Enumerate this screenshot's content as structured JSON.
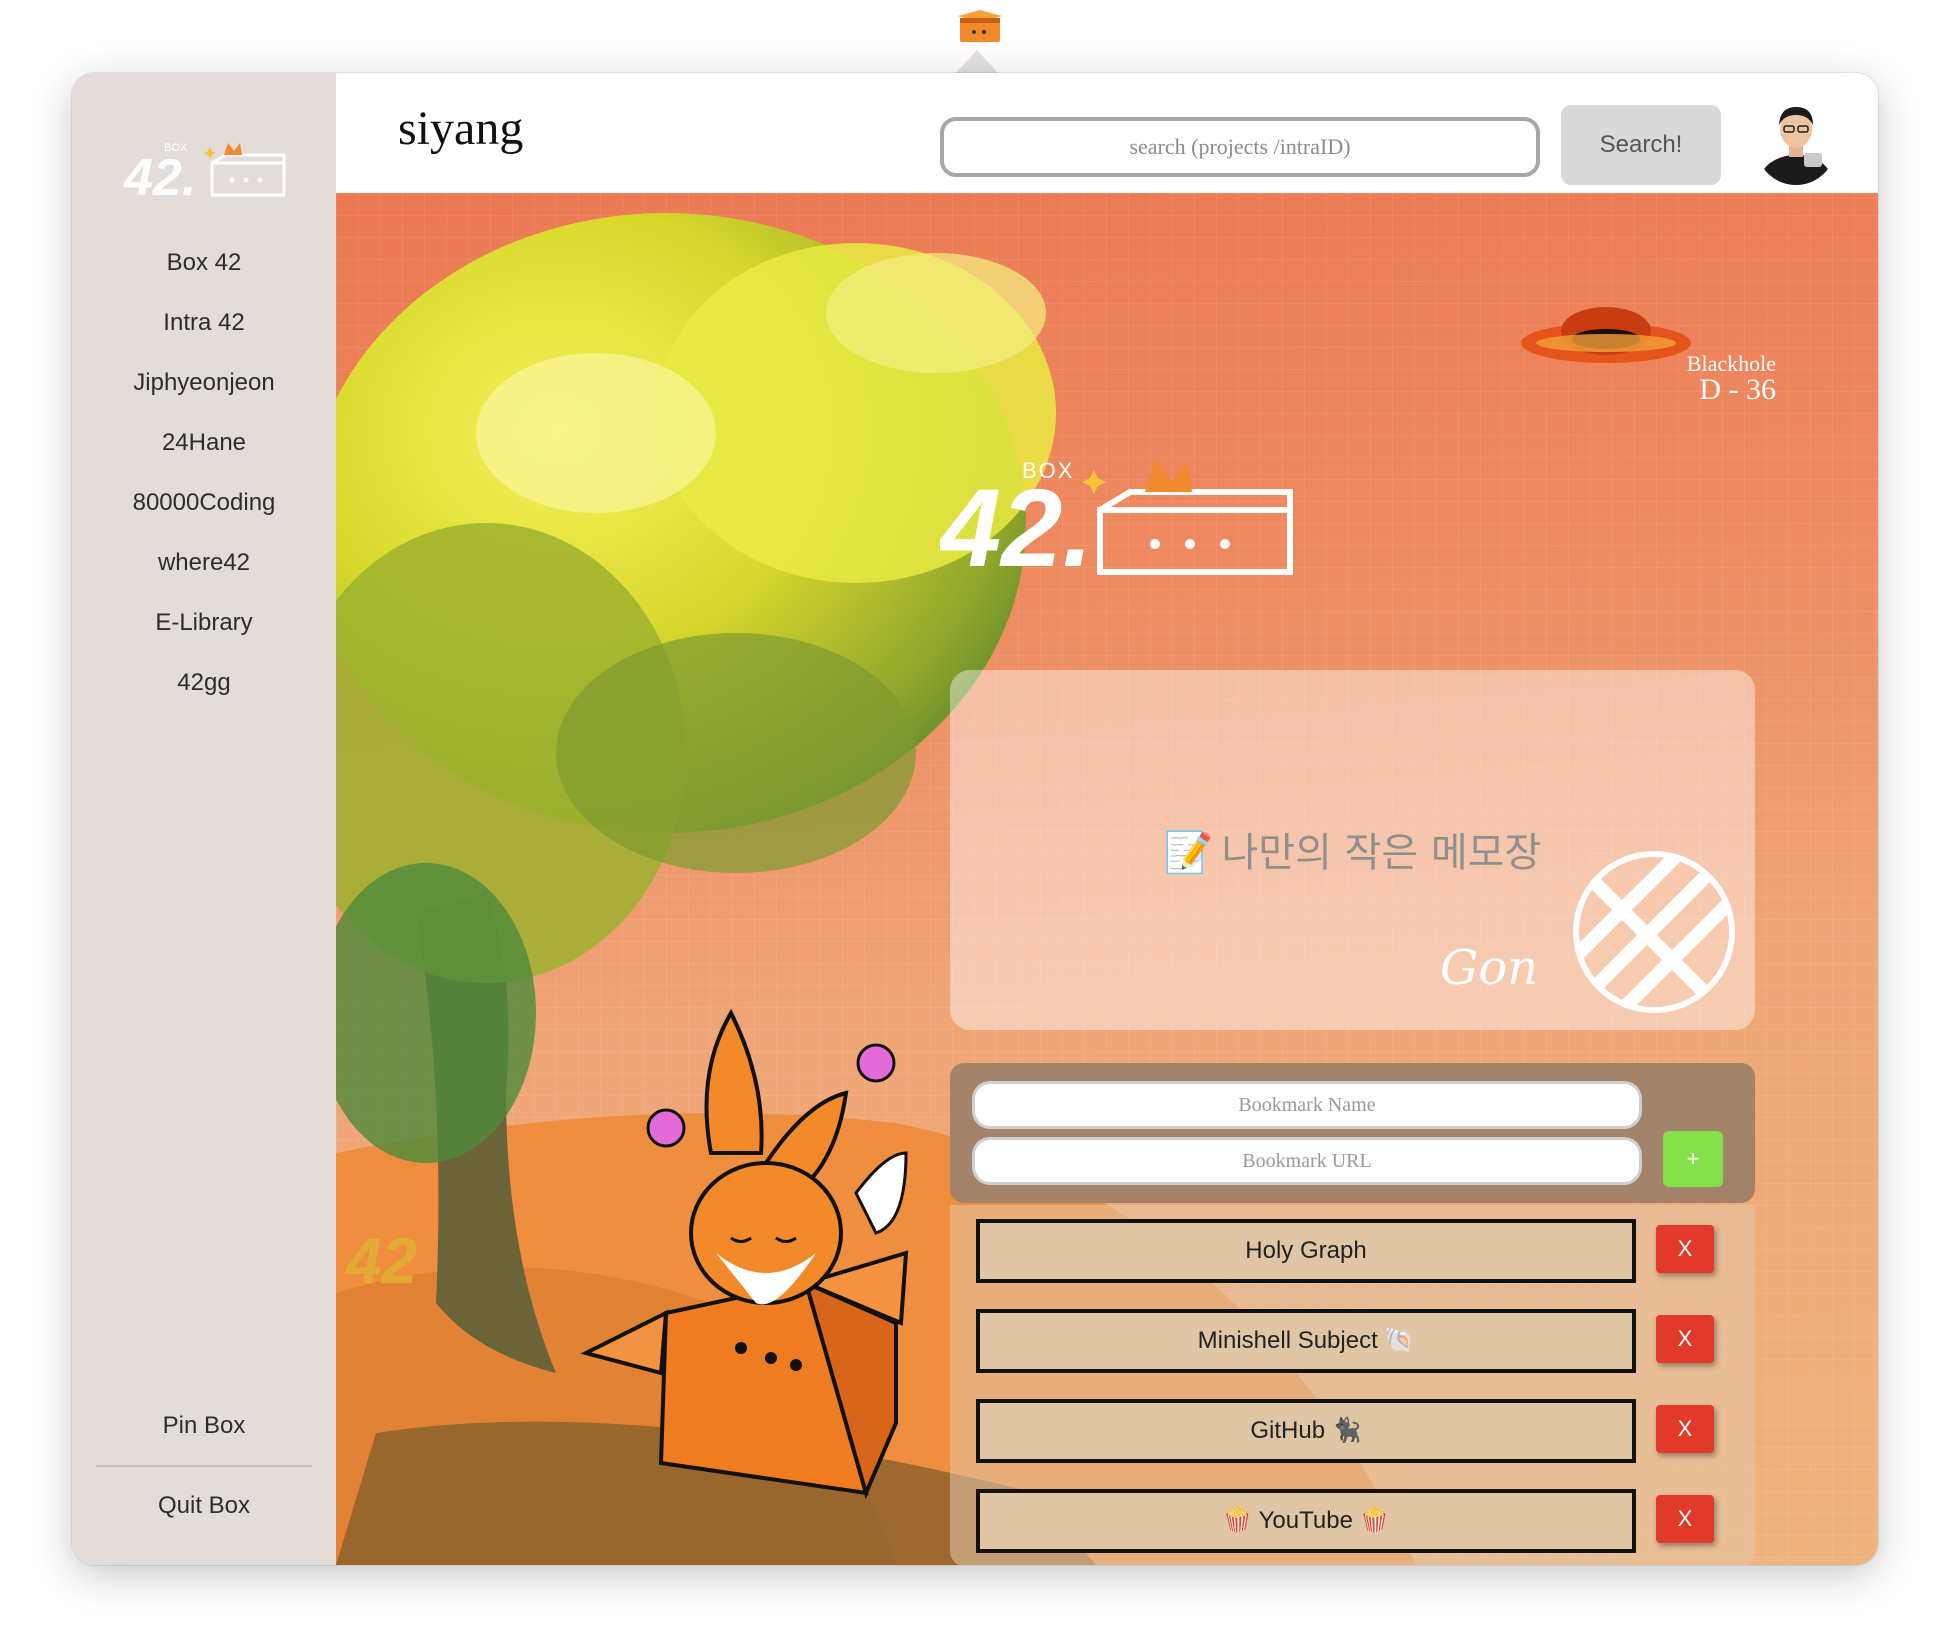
{
  "window": {
    "tray_icon": "box-42-tray-icon"
  },
  "sidebar": {
    "logo_icon": "box-42-logo",
    "items": [
      {
        "label": "Box 42"
      },
      {
        "label": "Intra 42"
      },
      {
        "label": "Jiphyeonjeon"
      },
      {
        "label": "24Hane"
      },
      {
        "label": "80000Coding"
      },
      {
        "label": "where42"
      },
      {
        "label": "E-Library"
      },
      {
        "label": "42gg"
      }
    ],
    "pin_label": "Pin Box",
    "quit_label": "Quit Box"
  },
  "header": {
    "user_name": "siyang",
    "search_placeholder": "search (projects /intraID)",
    "search_value": "",
    "search_button": "Search!",
    "avatar_icon": "user-avatar"
  },
  "blackhole": {
    "title": "Blackhole",
    "days": "D - 36",
    "icon": "blackhole-icon"
  },
  "memo": {
    "title": "나만의 작은 메모장",
    "title_emoji": "📝",
    "signature_icon": "gon-signature",
    "emblem_icon": "42-emblem"
  },
  "bookmark_form": {
    "name_placeholder": "Bookmark Name",
    "url_placeholder": "Bookmark URL",
    "add_label": "+"
  },
  "bookmarks": [
    {
      "label": "Holy Graph",
      "delete_label": "X"
    },
    {
      "label": "Minishell Subject 🐚",
      "delete_label": "X"
    },
    {
      "label": "GitHub 🐈‍⬛",
      "delete_label": "X"
    },
    {
      "label": "🍿 YouTube 🍿",
      "delete_label": "X"
    }
  ],
  "colors": {
    "sidebar_bg": "#e3dcd9",
    "accent_orange": "#ec7a53",
    "add_button": "#86e04a",
    "delete_button": "#e23a2a",
    "bookmark_form_bg": "#a3846a"
  }
}
